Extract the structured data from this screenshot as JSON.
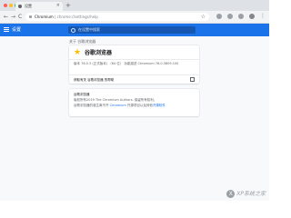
{
  "window": {
    "traffic_lights": [
      "#ff5f57",
      "#febc2e",
      "#28c840"
    ]
  },
  "tab": {
    "title": "设置",
    "close_icon": "×",
    "new_tab_icon": "+"
  },
  "toolbar": {
    "back_icon": "←",
    "forward_icon": "→",
    "reload_icon": "C",
    "url_host": "Chromium",
    "url_path": " | chrome://settings/help",
    "bookmark_icon": "☆",
    "menu_icon": "⋮"
  },
  "settings": {
    "title": "设置",
    "search_placeholder": "在设置中搜索",
    "accent": "#1a73e8"
  },
  "about": {
    "section_title": "关于 谷歌浏览器",
    "product_name": "谷歌浏览器",
    "logo": "chromium-logo",
    "version": "版本 76.0.3 (正式版本) （64 位）  功能描述 Chromium 76.0.3809.100",
    "help_label": "获取有关 谷歌浏览器 的帮助"
  },
  "info": {
    "name": "谷歌浏览器",
    "copyright": "版权所有2019 The Chromium Authors. 保留所有权利。",
    "credits_prefix": "谷歌浏览器的诞生离不开 ",
    "credits_link1": "Chromium",
    "credits_mid": " 开源项目以及其他",
    "credits_link2": "开源软件"
  },
  "watermark": {
    "text": "XP系统之家"
  }
}
